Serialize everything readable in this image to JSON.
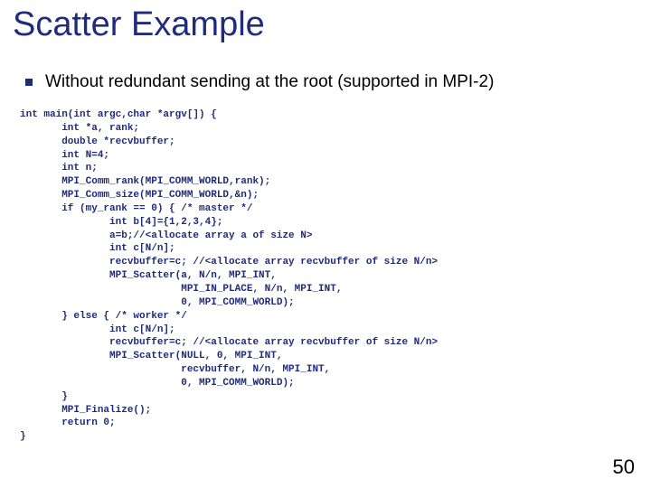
{
  "title": "Scatter Example",
  "bullet": "Without redundant sending at the root (supported in MPI-2)",
  "code": "int main(int argc,char *argv[]) {\n       int *a, rank;\n       double *recvbuffer;\n       int N=4;\n       int n;\n       MPI_Comm_rank(MPI_COMM_WORLD,rank);\n       MPI_Comm_size(MPI_COMM_WORLD,&n);\n       if (my_rank == 0) { /* master */\n               int b[4]={1,2,3,4};\n               a=b;//<allocate array a of size N>\n               int c[N/n];\n               recvbuffer=c; //<allocate array recvbuffer of size N/n>\n               MPI_Scatter(a, N/n, MPI_INT,\n                           MPI_IN_PLACE, N/n, MPI_INT,\n                           0, MPI_COMM_WORLD);\n       } else { /* worker */\n               int c[N/n];\n               recvbuffer=c; //<allocate array recvbuffer of size N/n>\n               MPI_Scatter(NULL, 0, MPI_INT,\n                           recvbuffer, N/n, MPI_INT,\n                           0, MPI_COMM_WORLD);\n       }\n       MPI_Finalize();\n       return 0;\n}",
  "page_number": "50"
}
